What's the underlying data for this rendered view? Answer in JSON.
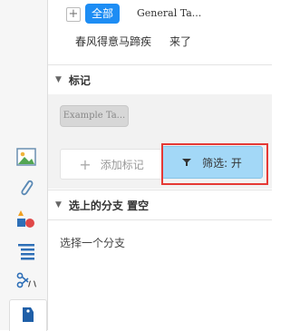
{
  "tags": {
    "add_symbol": "+",
    "all_label": "全部",
    "general_label": "General Ta...",
    "row2": [
      "春风得意马蹄疾",
      "来了"
    ]
  },
  "tag_section": {
    "arrow": "▼",
    "title": "标记",
    "example_chip": "Example Ta...",
    "add_label": "添加标记",
    "filter_label": "筛选: 开"
  },
  "branch_section": {
    "arrow": "▼",
    "title": "选上的分支 置空",
    "placeholder": "选择一个分支"
  },
  "colors": {
    "accent_blue": "#1d8df4",
    "filter_bg": "#a3d8f7",
    "highlight_red": "#e53935"
  },
  "sidebar_icons": [
    "image-icon",
    "paperclip-icon",
    "shapes-icon",
    "list-icon",
    "scissors-icon",
    "tag-icon"
  ]
}
